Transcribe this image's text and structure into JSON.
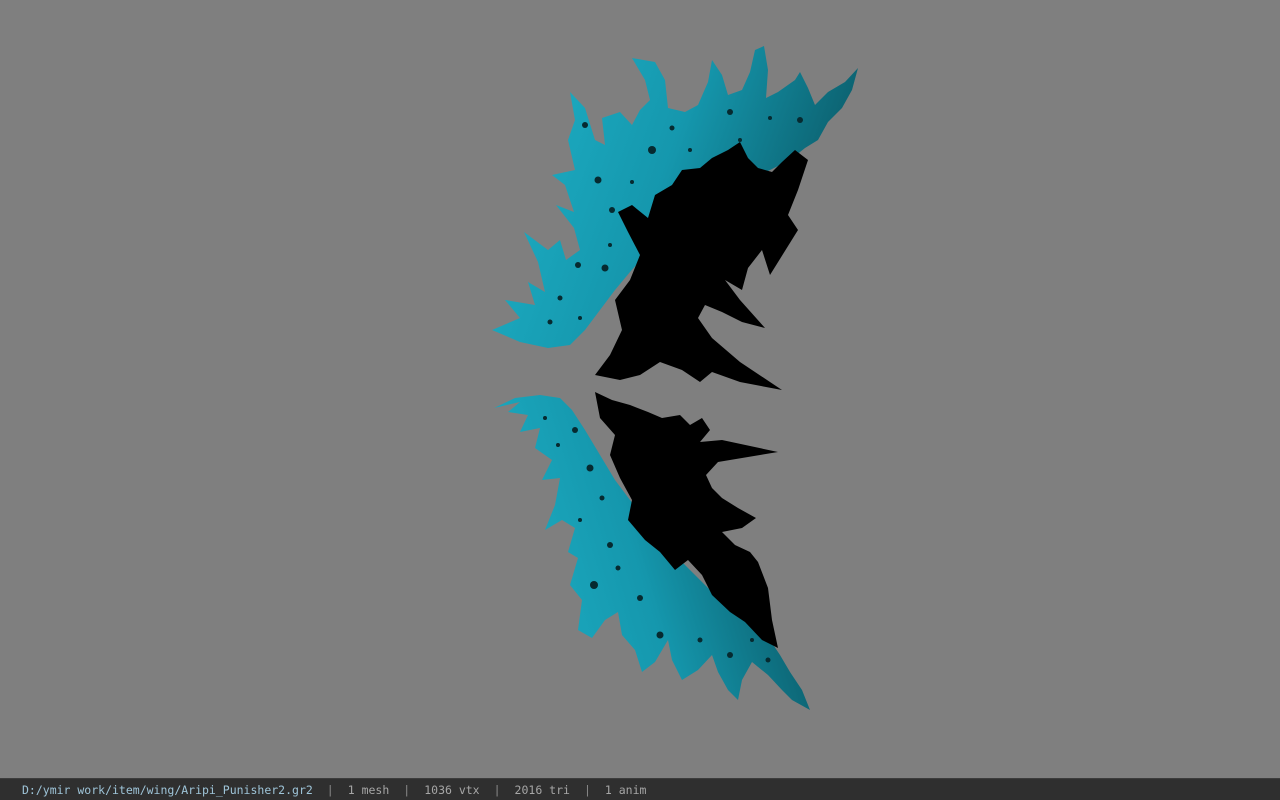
{
  "viewer": {
    "background_color": "#7f7f7f",
    "model_name": "Aripi_Punisher2",
    "model_colors": {
      "primary": "#1aa6bd",
      "shadow": "#000000"
    }
  },
  "statusbar": {
    "file_path": "D:/ymir work/item/wing/Aripi_Punisher2.gr2",
    "mesh_count": "1 mesh",
    "vertex_count": "1036 vtx",
    "triangle_count": "2016 tri",
    "anim_count": "1 anim",
    "separator": "|"
  }
}
